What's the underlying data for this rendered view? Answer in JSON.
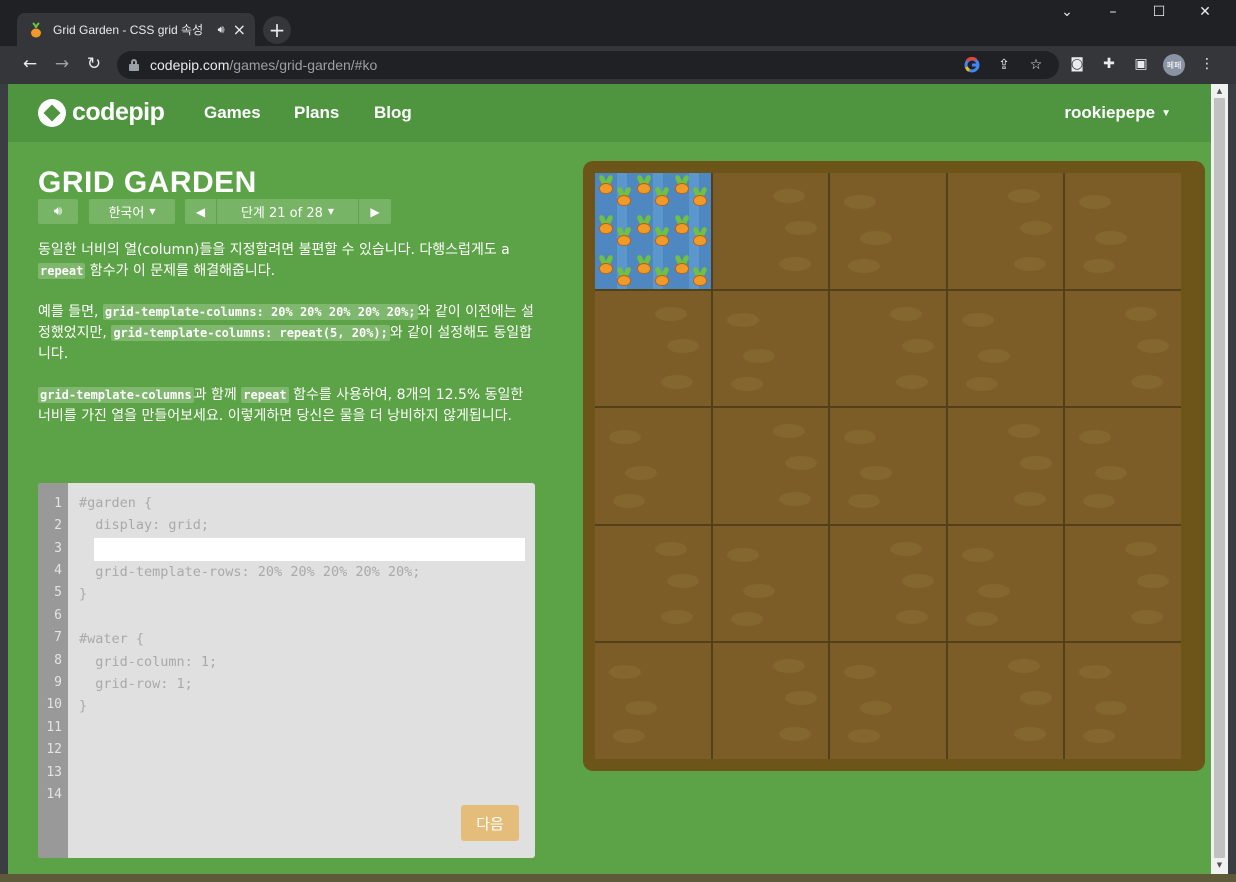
{
  "browser": {
    "tab_title": "Grid Garden - CSS grid 속성",
    "url_host": "codepip.com",
    "url_path": "/games/grid-garden/#ko",
    "profile_initials": "페페"
  },
  "site": {
    "logo_text": "codepip",
    "nav": [
      "Games",
      "Plans",
      "Blog"
    ],
    "user": "rookiepepe"
  },
  "game": {
    "title": "GRID GARDEN",
    "language": "한국어",
    "level_label": "단계 21 of 28",
    "instructions": {
      "p1_a": "동일한 너비의 열(column)들을 지정할려면 불편할 수 있습니다. 다행스럽게도 a ",
      "p1_code": "repeat",
      "p1_b": " 함수가 이 문제를 해결해줍니다.",
      "p2_a": "예를 들면, ",
      "p2_code1": "grid-template-columns: 20% 20% 20% 20% 20%;",
      "p2_b": "와 같이 이전에는 설정했었지만, ",
      "p2_code2": "grid-template-columns: repeat(5, 20%);",
      "p2_c": "와 같이 설정해도 동일합니다.",
      "p3_code1": "grid-template-columns",
      "p3_a": "과 함께 ",
      "p3_code2": "repeat",
      "p3_b": " 함수를 사용하여, 8개의 12.5% 동일한 너비를 가진 열을 만들어보세요. 이렇게하면 당신은 물을 더 낭비하지 않게됩니다."
    },
    "editor": {
      "line_numbers": [
        "1",
        "2",
        "3",
        "4",
        "5",
        "6",
        "7",
        "8",
        "9",
        "10",
        "11",
        "12",
        "13",
        "14"
      ],
      "lines": [
        "#garden {",
        "  display: grid;",
        "",
        "  grid-template-rows: 20% 20% 20% 20% 20%;",
        "}",
        "",
        "#water {",
        "  grid-column: 1;",
        "  grid-row: 1;",
        "}"
      ],
      "answer_value": ""
    },
    "next_button": "다음",
    "garden": {
      "rows": 5,
      "columns": 5,
      "water_cell": {
        "column": 1,
        "row": 1
      },
      "carrots_in_water": 9
    }
  },
  "colors": {
    "page_bg": "#5ba346",
    "nav_bg": "#4f9540",
    "soil": "#7c5d27",
    "water": "#4f88c0",
    "next_button": "#e5bd7a"
  }
}
